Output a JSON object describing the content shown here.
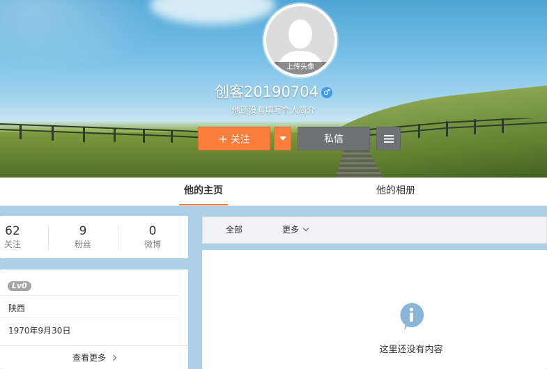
{
  "profile": {
    "avatar_upload_label": "上传头像",
    "username": "创客20190704",
    "gender_symbol": "♂",
    "bio": "他还没有填写个人简介"
  },
  "actions": {
    "follow_plus": "+",
    "follow_label": "关注",
    "message_label": "私信"
  },
  "tabs": [
    {
      "label": "他的主页"
    },
    {
      "label": "他的相册"
    }
  ],
  "stats": [
    {
      "value": "62",
      "label": "关注"
    },
    {
      "value": "9",
      "label": "粉丝"
    },
    {
      "value": "0",
      "label": "微博"
    }
  ],
  "info": {
    "level": "Lv0",
    "location": "陕西",
    "birthday": "1970年9月30日",
    "see_more": "查看更多"
  },
  "feed": {
    "filter_all": "全部",
    "filter_more": "更多",
    "empty_text": "这里还没有内容"
  },
  "colors": {
    "accent_orange": "#fa7d3c",
    "secondary_gray": "#6e7277",
    "page_bg": "#acd0e7",
    "info_icon": "#8ab6d6"
  }
}
